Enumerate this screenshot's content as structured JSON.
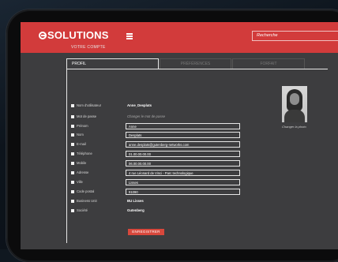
{
  "header": {
    "logo_text": "SOLUTIONS",
    "search_placeholder": "Recherche",
    "brand_color": "#d23b3b"
  },
  "page": {
    "section_title": "VOTRE COMPTE"
  },
  "tabs": [
    {
      "label": "PROFIL",
      "active": true
    },
    {
      "label": "PRÉFÉRENCES",
      "active": false
    },
    {
      "label": "FORFAIT",
      "active": false
    }
  ],
  "profile": {
    "labels": {
      "username": "Nom d'utilisateur",
      "password": "Mot de passe",
      "firstname": "Prénom",
      "lastname": "Nom",
      "email": "E-mail",
      "phone": "Téléphone",
      "mobile": "Mobile",
      "address": "Adresse",
      "city": "Ville",
      "postal_code": "Code postal",
      "business_unit": "Business Unit",
      "company": "Société"
    },
    "values": {
      "username": "Anne_Desplats",
      "password_link": "Changer le mot de passe",
      "firstname": "Anne",
      "lastname": "Desplats",
      "email": "anne.desplats@gutenberg-networks.com",
      "phone": "01.00.00.00.00",
      "mobile": "06.00.00.00.00",
      "address": "4 rue Léonard de Vinci - Parc technologique",
      "city": "Lisses",
      "postal_code": "91090",
      "business_unit": "BU Lisses",
      "company": "Gutenberg"
    },
    "photo_link": "Changer la photo",
    "save_label": "ENREGISTRER"
  }
}
